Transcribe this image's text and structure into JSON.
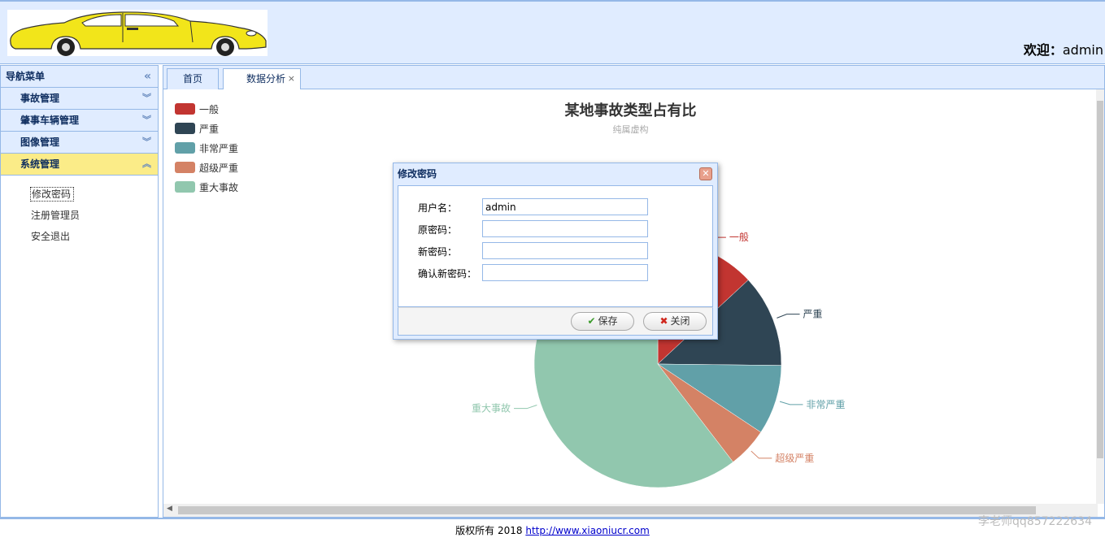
{
  "header": {
    "welcome_label": "欢迎：",
    "username": "admin"
  },
  "sidebar": {
    "title": "导航菜单",
    "sections": [
      {
        "label": "事故管理"
      },
      {
        "label": "肇事车辆管理"
      },
      {
        "label": "图像管理"
      },
      {
        "label": "系统管理"
      }
    ],
    "sub_items": [
      {
        "label": "修改密码"
      },
      {
        "label": "注册管理员"
      },
      {
        "label": "安全退出"
      }
    ]
  },
  "tabs": [
    {
      "label": "首页"
    },
    {
      "label": "数据分析",
      "close": "×"
    }
  ],
  "chart_data": {
    "type": "pie",
    "title": "某地事故类型占有比",
    "subtitle": "纯属虚构",
    "legend": [
      "一般",
      "严重",
      "非常严重",
      "超级严重",
      "重大事故"
    ],
    "values": [
      335,
      310,
      234,
      135,
      1548
    ],
    "colors": [
      "#c23531",
      "#2f4554",
      "#61a0a8",
      "#d48265",
      "#91c7ae"
    ]
  },
  "dialog": {
    "title": "修改密码",
    "fields": [
      {
        "label": "用户名：",
        "value": "admin"
      },
      {
        "label": "原密码：",
        "value": ""
      },
      {
        "label": "新密码：",
        "value": ""
      },
      {
        "label": "确认新密码：",
        "value": ""
      }
    ],
    "save_label": "保存",
    "close_label": "关闭"
  },
  "footer": {
    "text": "版权所有 2018 ",
    "link": "http://www.xiaoniucr.com"
  },
  "watermark": "李老师qq857222634"
}
